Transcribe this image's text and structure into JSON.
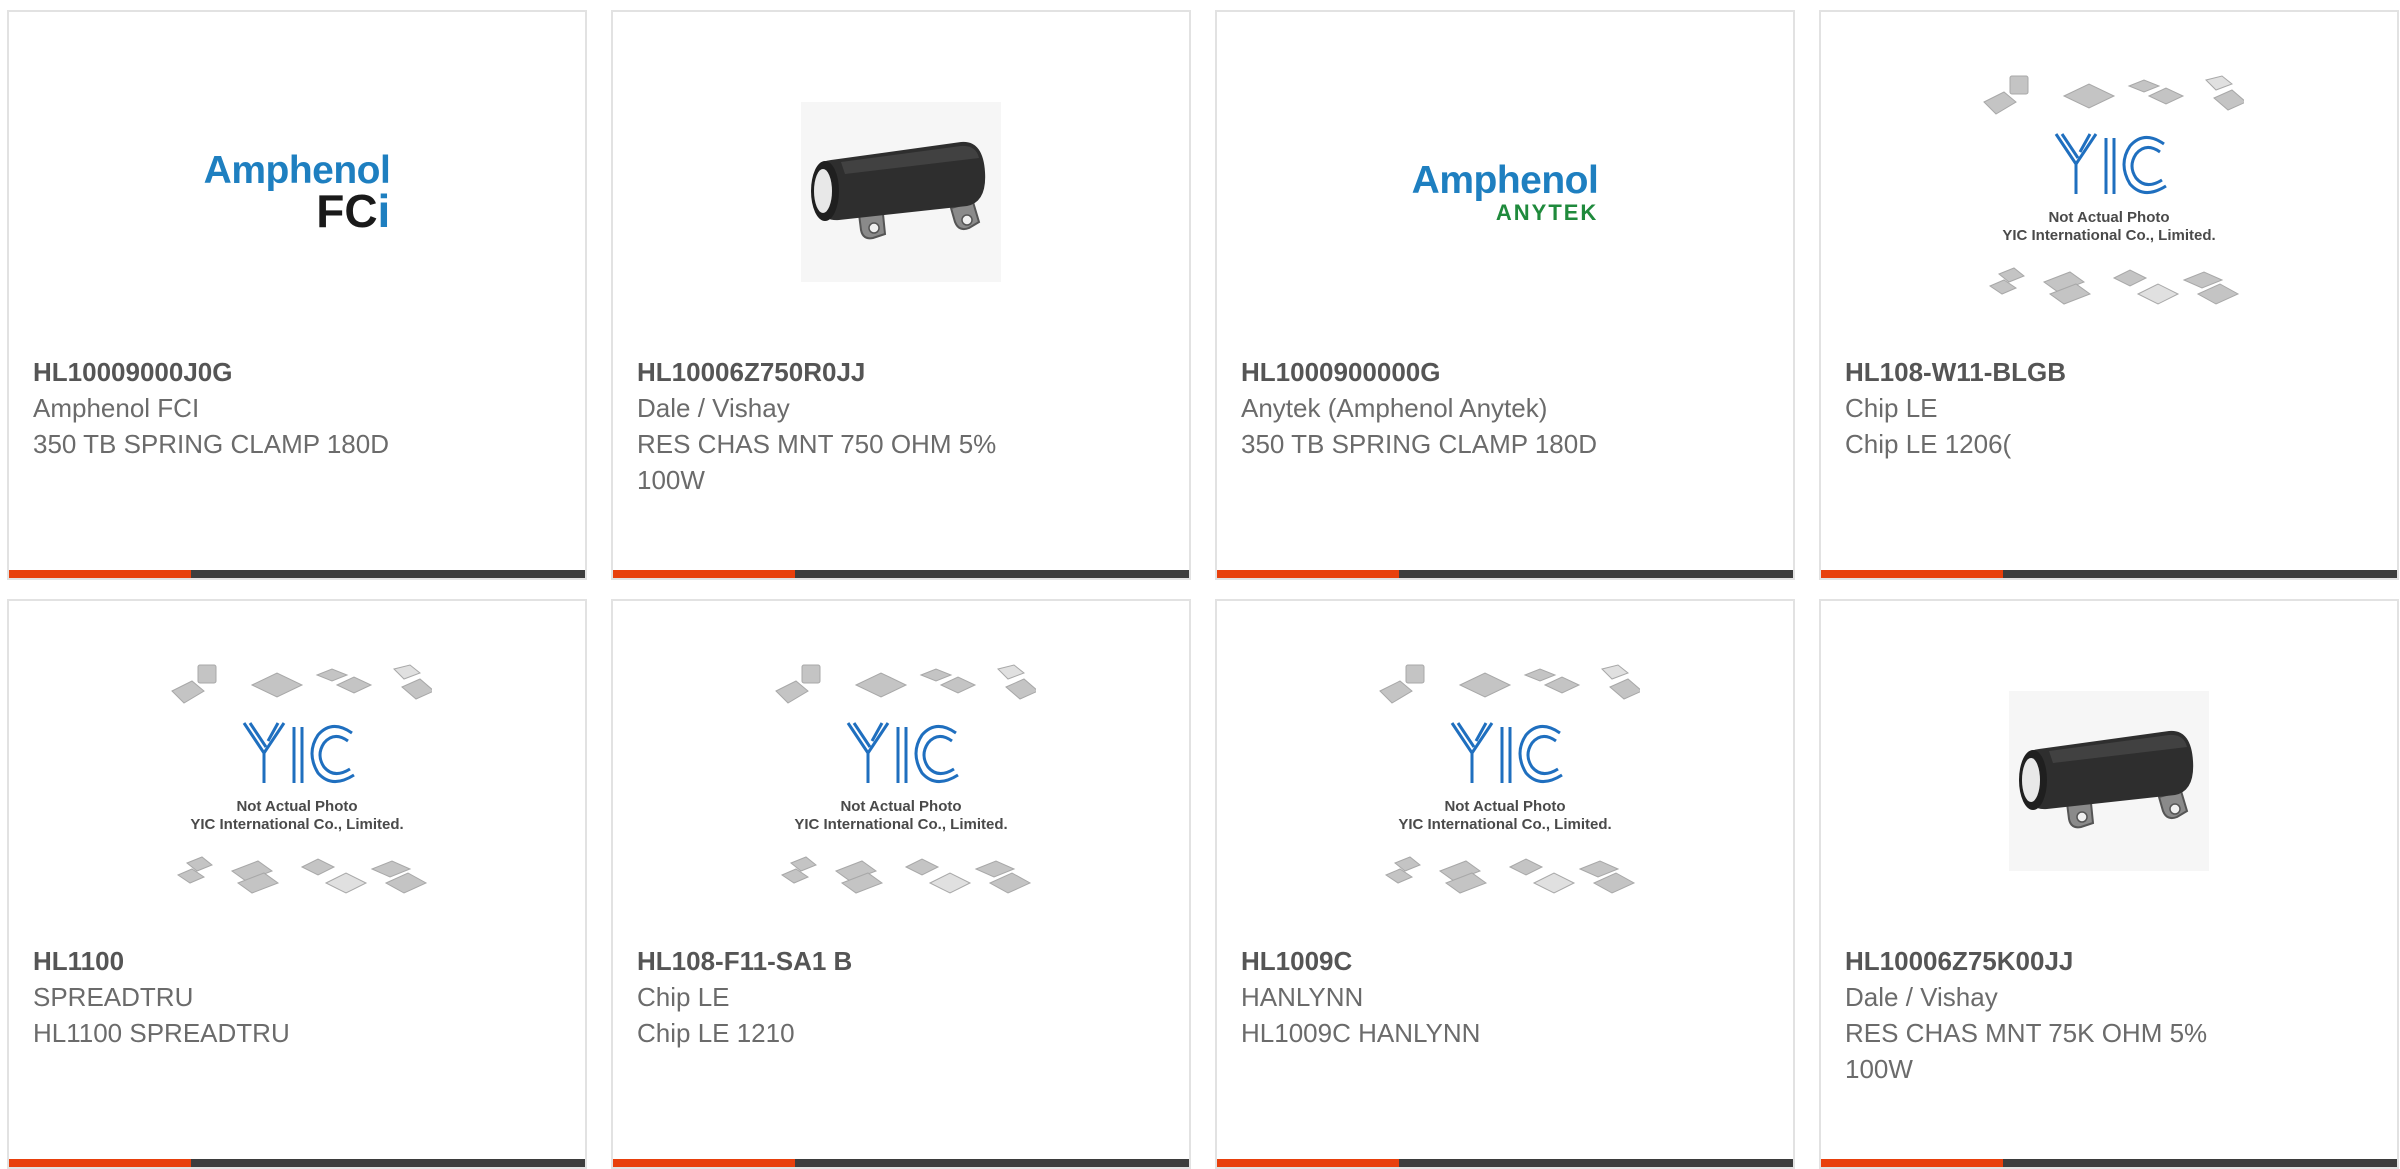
{
  "colors": {
    "accent": "#e8400c",
    "bar": "#3d3d3d",
    "border": "#e2e2e2",
    "text": "#6b6b6b",
    "amphenol_blue": "#1e7fc0",
    "anytek_green": "#1f8a3c"
  },
  "products": [
    {
      "part_number": "HL10009000J0G",
      "manufacturer": "Amphenol FCI",
      "description": "350 TB SPRING CLAMP 180D",
      "image": "amphenol-fci-logo",
      "logo": {
        "brand": "Amphenol",
        "sub": "FC",
        "sub_i": "i"
      }
    },
    {
      "part_number": "HL10006Z750R0JJ",
      "manufacturer": "Dale / Vishay",
      "description": "RES CHAS MNT 750 OHM 5% 100W",
      "image": "resistor-photo"
    },
    {
      "part_number": "HL1000900000G",
      "manufacturer": "Anytek (Amphenol Anytek)",
      "description": "350 TB SPRING CLAMP 180D",
      "image": "amphenol-anytek-logo",
      "logo": {
        "brand": "Amphenol",
        "sub": "ANYTEK"
      }
    },
    {
      "part_number": "HL108-W11-BLGB",
      "manufacturer": "Chip LE",
      "description": "Chip LE 1206(",
      "image": "yic-placeholder"
    },
    {
      "part_number": "HL1100",
      "manufacturer": "SPREADTRU",
      "description": "HL1100 SPREADTRU",
      "image": "yic-placeholder"
    },
    {
      "part_number": "HL108-F11-SA1 B",
      "manufacturer": "Chip LE",
      "description": "Chip LE 1210",
      "image": "yic-placeholder"
    },
    {
      "part_number": "HL1009C",
      "manufacturer": "HANLYNN",
      "description": "HL1009C HANLYNN",
      "image": "yic-placeholder"
    },
    {
      "part_number": "HL10006Z75K00JJ",
      "manufacturer": "Dale / Vishay",
      "description": "RES CHAS MNT 75K OHM 5% 100W",
      "image": "resistor-photo"
    }
  ],
  "placeholder": {
    "line1": "Not Actual Photo",
    "line2": "YIC International Co., Limited.",
    "mark": "YIC"
  }
}
